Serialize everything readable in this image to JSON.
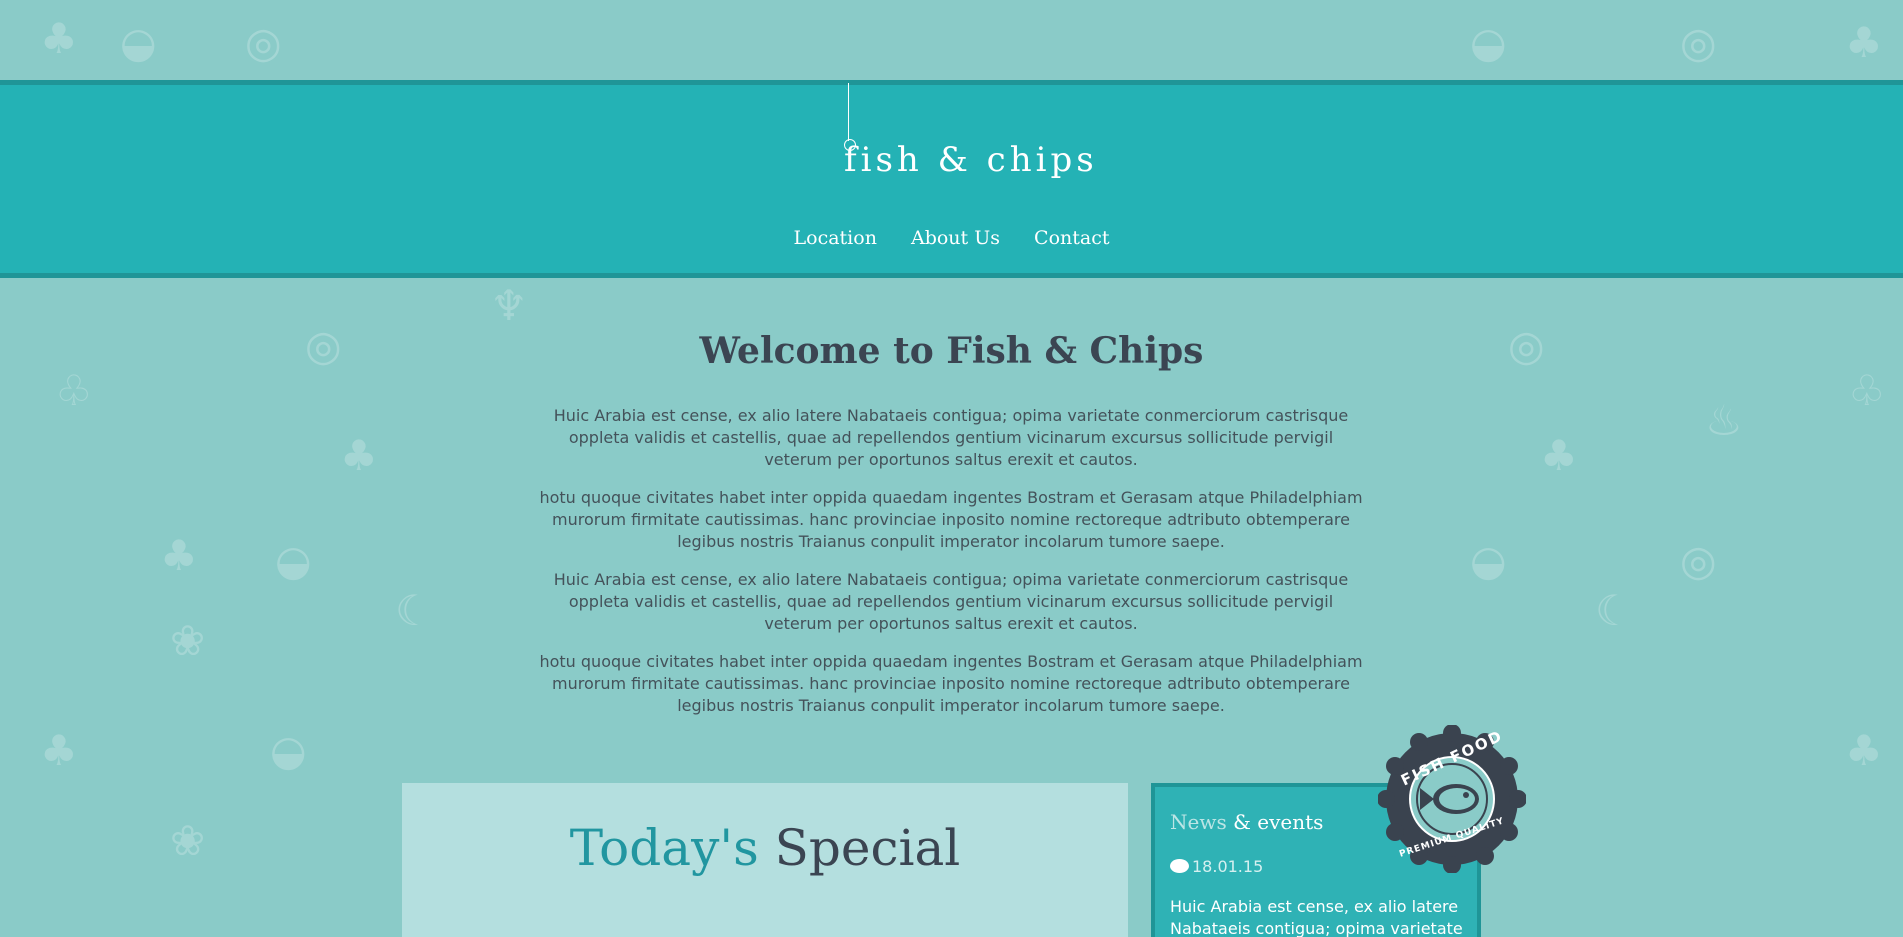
{
  "header": {
    "logo": "fish & chips",
    "nav": [
      {
        "label": "Location"
      },
      {
        "label": "About Us"
      },
      {
        "label": "Contact"
      }
    ]
  },
  "welcome": {
    "title": "Welcome to Fish & Chips",
    "paragraphs": [
      "Huic Arabia est cense, ex alio latere Nabataeis contigua; opima varietate conmerciorum castrisque oppleta validis et castellis, quae ad repellendos gentium vicinarum excursus sollicitude pervigil veterum per oportunos saltus erexit et cautos.",
      "hotu quoque civitates habet inter oppida quaedam ingentes Bostram et Gerasam atque Philadelphiam murorum firmitate cautissimas. hanc provinciae inposito nomine rectoreque adtributo obtemperare legibus nostris Traianus conpulit imperator incolarum tumore saepe.",
      "Huic Arabia est cense, ex alio latere Nabataeis contigua; opima varietate conmerciorum castrisque oppleta validis et castellis, quae ad repellendos gentium vicinarum excursus sollicitude pervigil veterum per oportunos saltus erexit et cautos.",
      "hotu quoque civitates habet inter oppida quaedam ingentes Bostram et Gerasam atque Philadelphiam murorum firmitate cautissimas. hanc provinciae inposito nomine rectoreque adtributo obtemperare legibus nostris Traianus conpulit imperator incolarum tumore saepe."
    ]
  },
  "special": {
    "title_accent": "Today's",
    "title_main": "Special"
  },
  "news": {
    "title_muted": "News",
    "title_main": "& events",
    "date": "18.01.15",
    "text": "Huic Arabia est cense, ex alio latere Nabataeis contigua; opima varietate"
  },
  "badge": {
    "top_text": "FISH FOOD",
    "bottom_text": "PREMIUM QUALITY"
  },
  "colors": {
    "background": "#8acbc8",
    "header": "#24b2b5",
    "header_border": "#1f9597",
    "heading_text": "#3b4552",
    "accent": "#2196a0",
    "special_panel": "#b4dfdf",
    "news_panel": "#2fb2b5",
    "badge": "#3a434f"
  },
  "icons": {
    "background": [
      "pineapple-icon",
      "watermelon-icon",
      "donut-icon",
      "broccoli-icon",
      "cherry-icon",
      "wine-glass-icon",
      "grill-icon",
      "banana-icon",
      "grapes-icon"
    ],
    "logo_hook": "fish-hook-icon",
    "news_date": "speech-bubble-icon",
    "badge_center": "fish-icon"
  }
}
